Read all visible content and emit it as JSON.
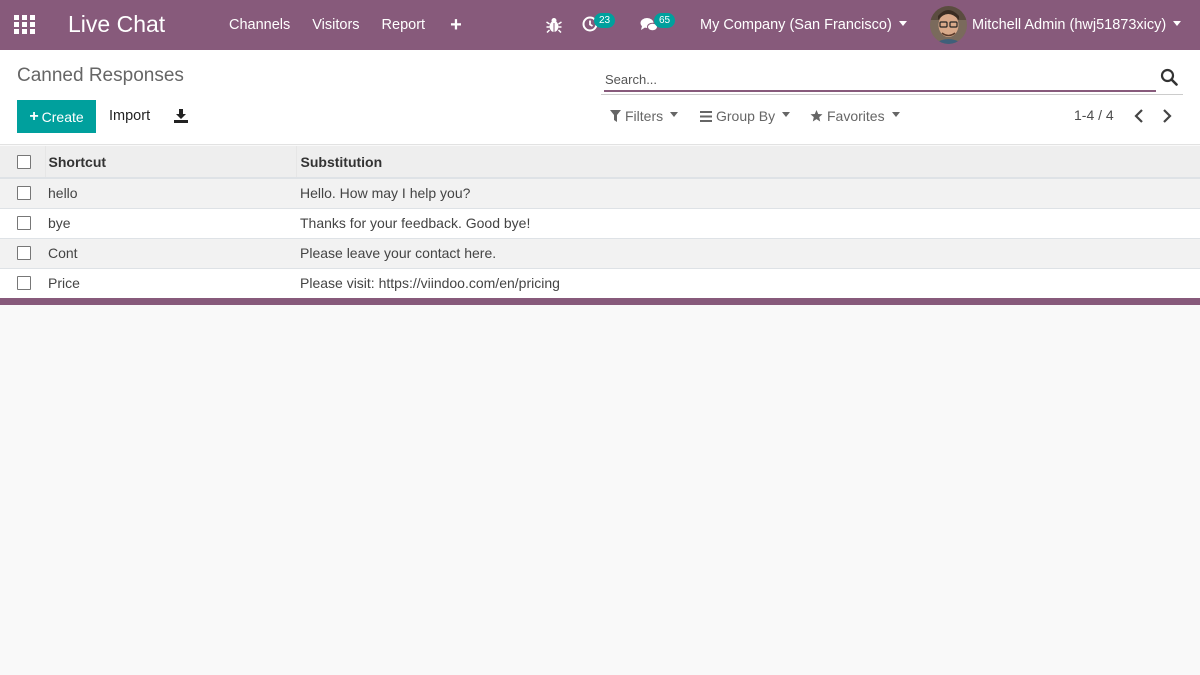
{
  "colors": {
    "brand": "#875a7b",
    "accent": "#00a09d"
  },
  "navbar": {
    "app_title": "Live Chat",
    "menu": [
      "Channels",
      "Visitors",
      "Report"
    ],
    "plus_label": "+",
    "activity_count": "23",
    "messages_count": "65",
    "company": "My Company (San Francisco)",
    "user": "Mitchell Admin (hwj51873xicy)"
  },
  "control_panel": {
    "breadcrumb": "Canned Responses",
    "search_placeholder": "Search...",
    "create_label": "Create",
    "import_label": "Import",
    "filters_label": "Filters",
    "group_by_label": "Group By",
    "favorites_label": "Favorites",
    "pager": "1-4 / 4"
  },
  "list": {
    "columns": [
      "Shortcut",
      "Substitution"
    ],
    "rows": [
      {
        "shortcut": "hello",
        "substitution": "Hello. How may I help you?"
      },
      {
        "shortcut": "bye",
        "substitution": "Thanks for your feedback. Good bye!"
      },
      {
        "shortcut": "Cont",
        "substitution": "Please leave your contact here."
      },
      {
        "shortcut": "Price",
        "substitution": "Please visit: https://viindoo.com/en/pricing"
      }
    ]
  }
}
